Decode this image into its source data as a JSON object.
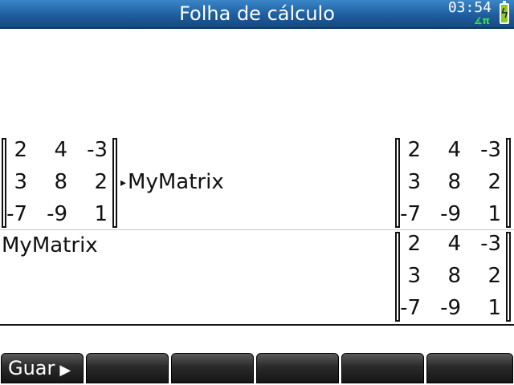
{
  "app": {
    "title": "Folha de cálculo",
    "clock": "03:54",
    "angle_mode": "∡π",
    "battery_icon": "battery-charging-icon"
  },
  "history": [
    {
      "input_matrix": [
        [
          "2",
          "4",
          "-3"
        ],
        [
          "3",
          "8",
          "2"
        ],
        [
          "-7",
          "-9",
          "1"
        ]
      ],
      "store_arrow": "▸",
      "input_target": "MyMatrix",
      "result_matrix": [
        [
          "2",
          "4",
          "-3"
        ],
        [
          "3",
          "8",
          "2"
        ],
        [
          "-7",
          "-9",
          "1"
        ]
      ]
    },
    {
      "input_text": "MyMatrix",
      "result_matrix": [
        [
          "2",
          "4",
          "-3"
        ],
        [
          "3",
          "8",
          "2"
        ],
        [
          "-7",
          "-9",
          "1"
        ]
      ]
    }
  ],
  "menu": {
    "keys": [
      {
        "label": "Guar",
        "arrow": "▶"
      },
      {
        "label": ""
      },
      {
        "label": ""
      },
      {
        "label": ""
      },
      {
        "label": ""
      },
      {
        "label": ""
      }
    ]
  }
}
